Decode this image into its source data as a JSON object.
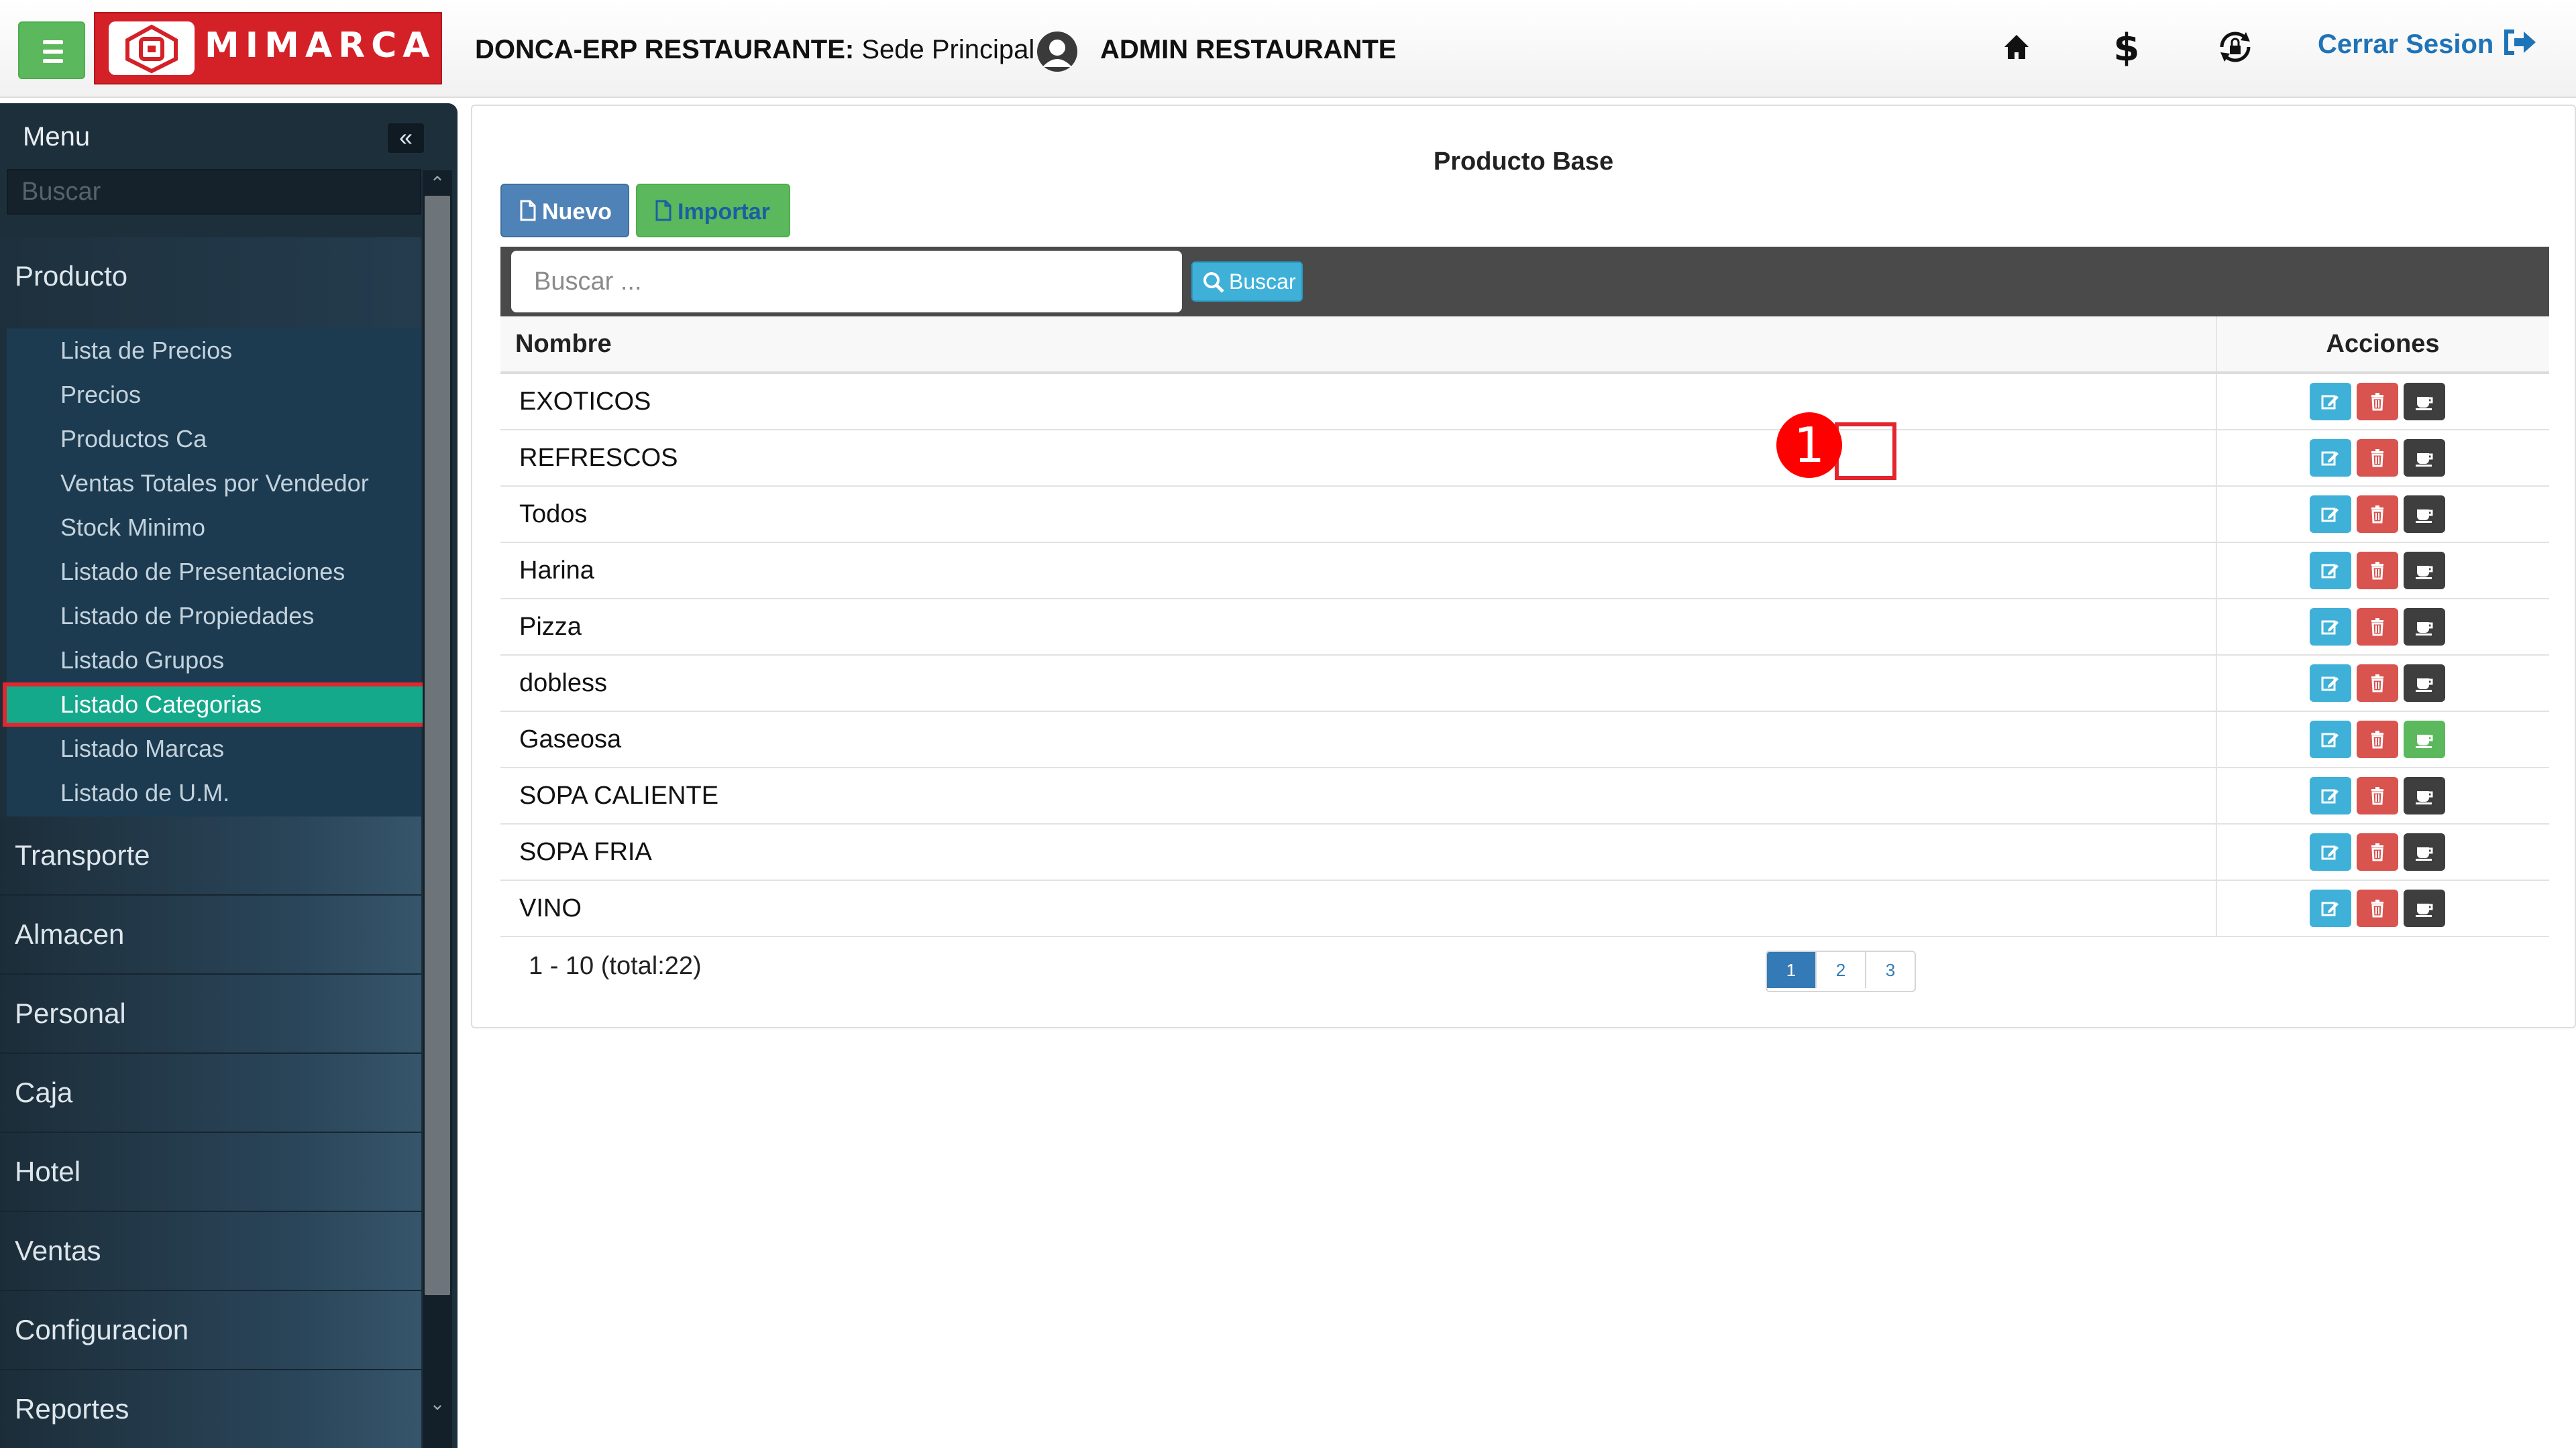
{
  "topbar": {
    "logo_text": "MIMARCA",
    "system_name": "DONCA-ERP RESTAURANTE:",
    "branch": " Sede Principal | ",
    "user": "ADMIN RESTAURANTE",
    "logout_label": "Cerrar Sesion"
  },
  "sidebar": {
    "menu_label": "Menu",
    "search_placeholder": "Buscar",
    "open_section": "Producto",
    "submenu": [
      "Lista de Precios",
      "Precios",
      "Productos Ca",
      "Ventas Totales por Vendedor",
      "Stock Minimo",
      "Listado de Presentaciones",
      "Listado de Propiedades",
      "Listado Grupos",
      "Listado Categorias",
      "Listado Marcas",
      "Listado de U.M."
    ],
    "active_item": "Listado Categorias",
    "sections": [
      "Transporte",
      "Almacen",
      "Personal",
      "Caja",
      "Hotel",
      "Ventas",
      "Configuracion",
      "Reportes"
    ]
  },
  "main": {
    "title": "Producto Base",
    "new_button": "Nuevo",
    "import_button": "Importar",
    "search_placeholder": "Buscar ...",
    "search_button": "Buscar",
    "columns": [
      "Nombre",
      "Acciones"
    ],
    "rows": [
      "EXOTICOS",
      "REFRESCOS",
      "Todos",
      "Harina",
      "Pizza",
      "dobless",
      "Gaseosa",
      "SOPA CALIENTE",
      "SOPA FRIA",
      "VINO"
    ],
    "active_cup_row": "Gaseosa",
    "range_text": "1 - 10 (total:22)",
    "pages": [
      "1",
      "2",
      "3"
    ],
    "current_page": "1"
  },
  "annotation": {
    "step": "1"
  },
  "colors": {
    "brand_red": "#d42027",
    "green": "#5cb85c",
    "info_blue": "#3fb1d8",
    "danger_red": "#d9534f",
    "sidebar_bg": "#1e2f3c",
    "active_teal": "#15a98c",
    "link_blue": "#1f73b7"
  },
  "icons": [
    "hamburger-icon",
    "home-icon",
    "dollar-icon",
    "lock-refresh-icon",
    "logout-icon",
    "edit-icon",
    "trash-icon",
    "cup-icon",
    "file-icon",
    "search-icon",
    "chevron-double-left-icon",
    "avatar-icon"
  ]
}
